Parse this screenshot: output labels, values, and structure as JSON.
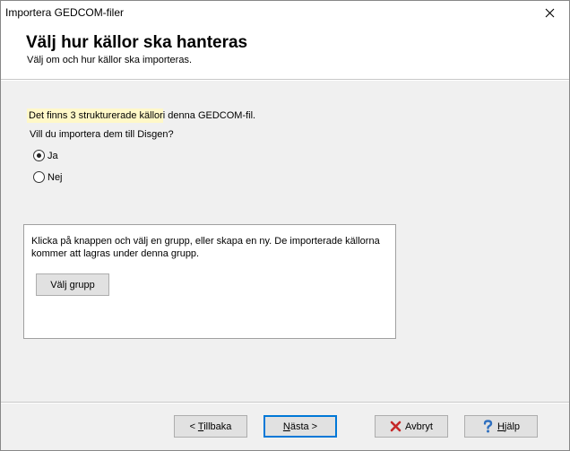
{
  "window": {
    "title": "Importera GEDCOM-filer"
  },
  "header": {
    "title": "Välj hur källor ska hanteras",
    "subtitle": "Välj om och hur källor ska importeras."
  },
  "intro": {
    "highlight": "Det finns 3 strukturerade källor",
    "rest": "i denna GEDCOM-fil."
  },
  "question": "Vill du importera dem till Disgen?",
  "options": [
    {
      "label": "Ja",
      "selected": true
    },
    {
      "label": "Nej",
      "selected": false
    }
  ],
  "group": {
    "description": "Klicka på knappen och välj en grupp, eller skapa en ny. De importerade källorna kommer att lagras under denna grupp.",
    "button_label": "Välj grupp"
  },
  "footer": {
    "back_prefix": "< ",
    "back_accel": "T",
    "back_rest": "illbaka",
    "next_accel": "N",
    "next_rest": "ästa >",
    "cancel_label": "Avbryt",
    "help_accel": "H",
    "help_rest": "jälp"
  },
  "colors": {
    "highlight": "#fff8c8",
    "cancel_icon": "#c62828",
    "help_icon": "#2e6fbf",
    "primary_border": "#0078d7"
  }
}
